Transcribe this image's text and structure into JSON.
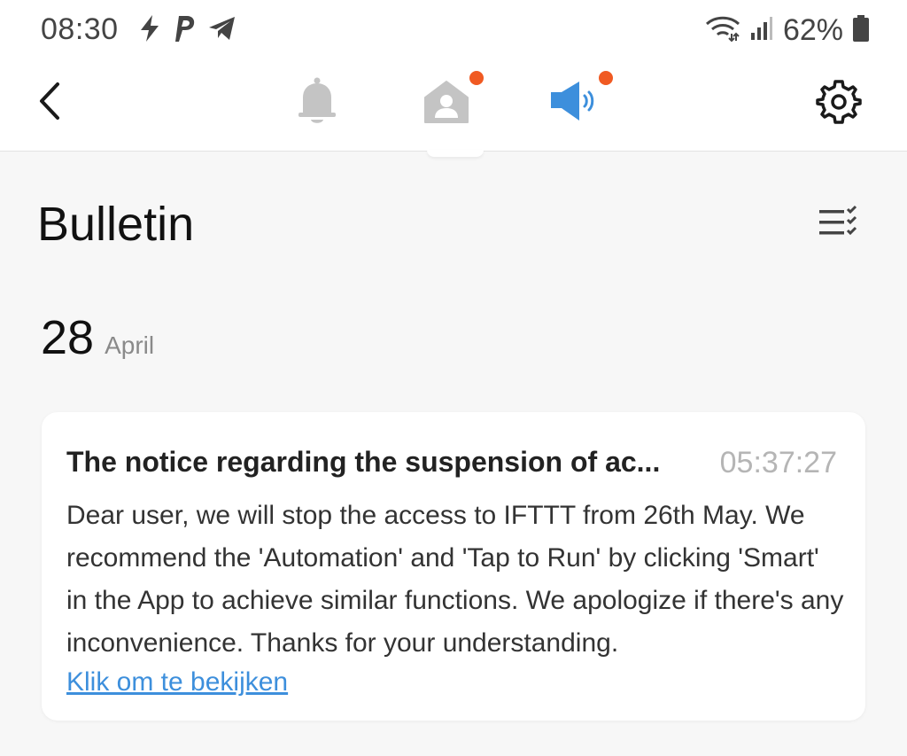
{
  "status_bar": {
    "time": "08:30",
    "battery": "62%",
    "left_icons": [
      "flash-icon",
      "pinterest-icon",
      "telegram-icon"
    ],
    "right_icons": [
      "wifi-icon",
      "signal-icon",
      "battery-icon"
    ]
  },
  "top_bar": {
    "back_icon": "chevron-left-icon",
    "tabs": [
      {
        "icon": "bell-icon",
        "has_dot": false,
        "active": false
      },
      {
        "icon": "home-person-icon",
        "has_dot": true,
        "active": false
      },
      {
        "icon": "speaker-icon",
        "has_dot": true,
        "active": true
      }
    ],
    "settings_icon": "gear-icon"
  },
  "page": {
    "title": "Bulletin",
    "mark_all_icon": "checklist-icon"
  },
  "bulletins": [
    {
      "day": "28",
      "month": "April",
      "title": "The notice regarding the suspension of ac...",
      "time": "05:37:27",
      "body": "Dear user, we will stop the access to IFTTT from 26th May. We recommend the 'Automation' and 'Tap to Run' by clicking 'Smart' in the App to achieve similar functions. We apologize if there's any inconvenience. Thanks for your understanding.",
      "link": "Klik om te bekijken"
    }
  ],
  "colors": {
    "accent": "#3d8fdc",
    "notification_dot": "#f05a22",
    "inactive_icon": "#c4c4c4",
    "background": "#f7f7f7"
  }
}
